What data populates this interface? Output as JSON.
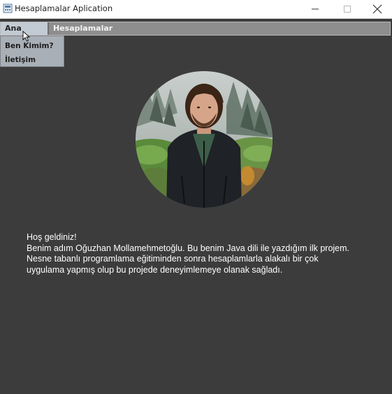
{
  "window": {
    "title": "Hesaplamalar Aplication"
  },
  "menubar": {
    "items": [
      {
        "label": "Ana Sayfa"
      },
      {
        "label": "Hesaplamalar"
      }
    ]
  },
  "dropdown": {
    "items": [
      {
        "label": "Ben Kimim?"
      },
      {
        "label": "İletişim"
      }
    ]
  },
  "content": {
    "welcome_lines": [
      "Hoş geldiniz!",
      "Benim adım Oğuzhan Mollamehmetoğlu. Bu benim Java dili ile yazdığım ilk projem.",
      "Nesne tabanlı programlama eğitiminden sonra hesaplamlarla alakalı bir çok",
      "uygulama yapmış olup bu projede deneyimlemeye olanak sağladı."
    ]
  },
  "colors": {
    "background": "#3c3c3c",
    "menubar": "#8e8e8e",
    "menu_active": "#c2cad3",
    "dropdown": "#a9afb6",
    "text": "#ffffff"
  }
}
